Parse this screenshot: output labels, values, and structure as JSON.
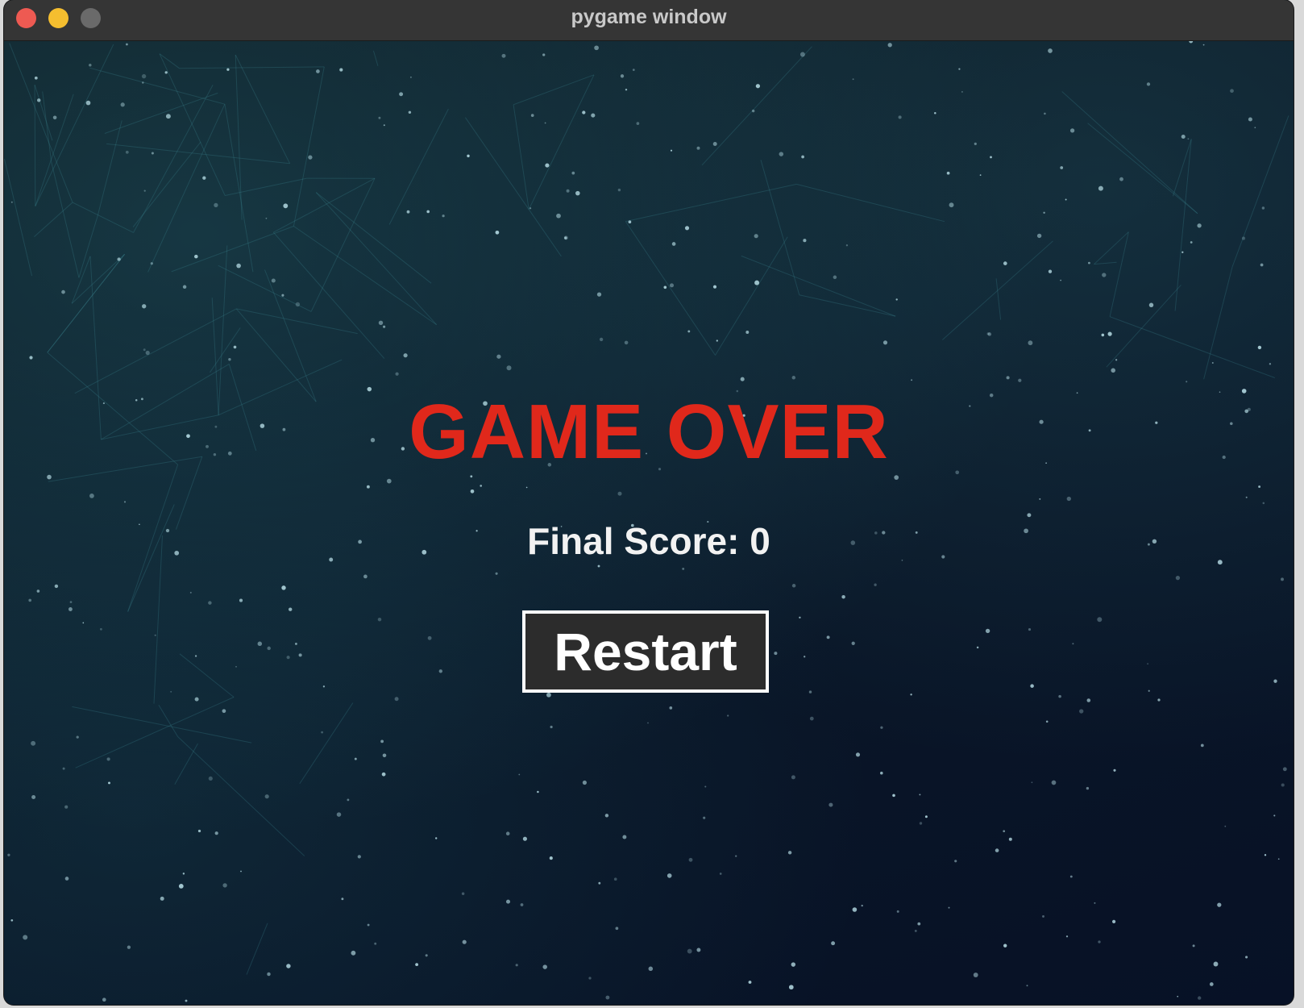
{
  "window": {
    "title": "pygame window",
    "controls": {
      "close_color": "#ee5a52",
      "minimize_color": "#f5be2f",
      "maximize_color": "#6a6a6a"
    }
  },
  "game": {
    "headline": "GAME OVER",
    "score_text": "Final Score: 0",
    "restart_label": "Restart"
  },
  "colors": {
    "headline": "#e0281b",
    "score": "#f2f2f2",
    "button_bg": "#2c2c2c",
    "button_border": "#ffffff",
    "background": "#0b1422"
  }
}
